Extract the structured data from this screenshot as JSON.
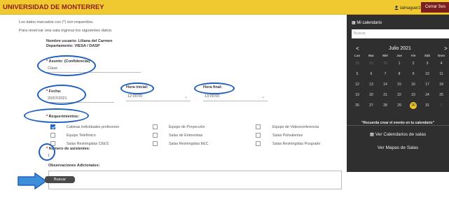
{
  "header": {
    "brand": "UNIVERSIDAD DE MONTERREY",
    "user": "laimaguer2",
    "logout": "Cerrar Ses"
  },
  "form": {
    "required_note": "Los datos marcados con (*) son requeridos.",
    "intro": "Para reservar una sala ingresa los siguientes datos:",
    "user_name": "Nombre usuario: Liliana del Carmen",
    "department": "Departamento: VIESA / DASP",
    "asunto_label": "Asunto: (Confidencial)",
    "asunto_value": "Clase",
    "fecha_label": "Fecha:",
    "fecha_value": "20/07/2021",
    "hora_inicial_label": "Hora inicial:",
    "hora_inicial_value": "12:00:00",
    "hora_final_label": "Hora final:",
    "hora_final_value": "13:00:00",
    "requerimientos_label": "Requerimientos:",
    "requirements": [
      {
        "label": "Cabinas individuales profesores",
        "checked": true
      },
      {
        "label": "Equipo de Proyección",
        "checked": false
      },
      {
        "label": "Equipo de Videoconferencia",
        "checked": false
      },
      {
        "label": "Equipo Telefónico",
        "checked": false
      },
      {
        "label": "Salas de Entrevistas",
        "checked": false
      },
      {
        "label": "Salas Polivalentes",
        "checked": false
      },
      {
        "label": "Salas Restringidas CEES",
        "checked": false
      },
      {
        "label": "Salas Restringidas EEC",
        "checked": false
      },
      {
        "label": "Salas Restringidas Posgrado",
        "checked": false
      }
    ],
    "asistentes_label": "Número de asistentes:",
    "asistentes_value": "1",
    "observaciones_label": "Observaciones Adicionales:",
    "buscar": "Buscar",
    "required_mark": "*"
  },
  "calendar": {
    "title": "Mi calendario",
    "search_placeholder": "Buscar",
    "prev": "<",
    "next": ">",
    "month": "Julio 2021",
    "dow": [
      "Lun",
      "Mar",
      "Mié",
      "Jue",
      "Vie",
      "Sáb",
      "Dom"
    ],
    "weeks": [
      [
        "28",
        "29",
        "30",
        "1",
        "2",
        "3",
        "4"
      ],
      [
        "5",
        "6",
        "7",
        "8",
        "9",
        "10",
        "11"
      ],
      [
        "12",
        "13",
        "14",
        "15",
        "16",
        "17",
        "18"
      ],
      [
        "19",
        "20",
        "21",
        "22",
        "23",
        "24",
        "25"
      ],
      [
        "26",
        "27",
        "28",
        "29",
        "30",
        "31",
        "1"
      ]
    ],
    "today": "30",
    "reminder": "\"Recuerda crear el evento en tu calendario\"",
    "link_calendars": "Ver Calendarios de salas",
    "link_maps": "Ver Mapas de Salas"
  },
  "colors": {
    "header_bg": "#f0c830",
    "brand": "#8b1c1c",
    "annotation": "#1f5fbf",
    "sidebar_bg": "#2f2f2f"
  }
}
